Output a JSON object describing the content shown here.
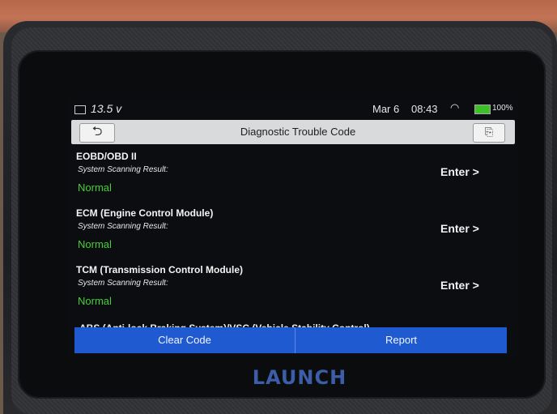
{
  "status_bar": {
    "voltage": "13.5",
    "voltage_unit": "v",
    "date": "Mar 6",
    "time": "08:43",
    "battery_percent": "100%",
    "wifi_icon": "wifi-icon",
    "battery_color": "#3fbf2a"
  },
  "header": {
    "back_icon": "back-arrow-icon",
    "title": "Diagnostic Trouble Code",
    "exit_icon": "exit-icon"
  },
  "systems": [
    {
      "name": "EOBD/OBD II",
      "subtitle": "System Scanning Result:",
      "status": "Normal",
      "action": "Enter >"
    },
    {
      "name": "ECM (Engine Control Module)",
      "subtitle": "System Scanning Result:",
      "status": "Normal",
      "action": "Enter >"
    },
    {
      "name": "TCM (Transmission Control Module)",
      "subtitle": "System Scanning Result:",
      "status": "Normal",
      "action": "Enter >"
    }
  ],
  "partial_item": "ABS (Anti-lock Braking System)/VSC (Vehicle Stability Control)",
  "footer": {
    "clear_label": "Clear Code",
    "report_label": "Report",
    "accent_color": "#1f5ad1"
  },
  "device": {
    "brand": "LAUNCH",
    "status_color": "#47d03a"
  }
}
